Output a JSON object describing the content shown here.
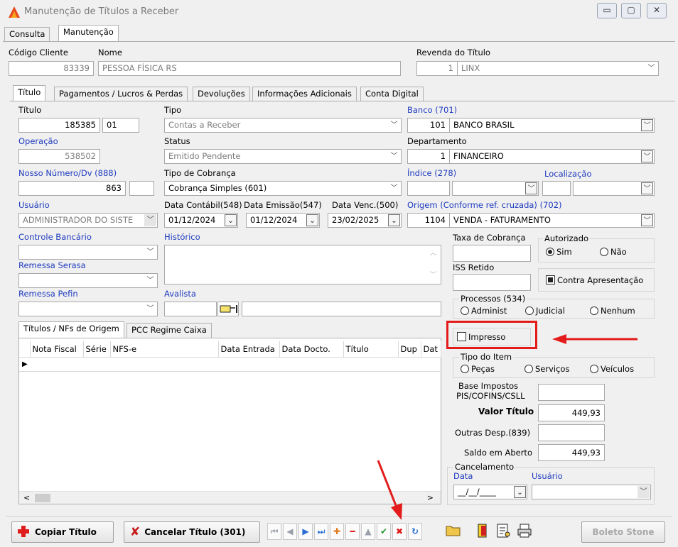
{
  "window": {
    "title": "Manutenção de Títulos a Receber",
    "min": "▭",
    "max": "▢",
    "close": "✕"
  },
  "main_tabs": [
    "Consulta",
    "Manutenção"
  ],
  "header": {
    "codigo_label": "Código Cliente",
    "codigo_value": "83339",
    "nome_label": "Nome",
    "nome_value": "PESSOA FÍSICA RS",
    "revenda_label": "Revenda do Título",
    "revenda_code": "1",
    "revenda_value": "LINX"
  },
  "sub_tabs": [
    "Título",
    "Pagamentos / Lucros & Perdas",
    "Devoluções",
    "Informações Adicionais",
    "Conta Digital"
  ],
  "titulo": {
    "titulo_label": "Título",
    "titulo_value": "185385",
    "parcela_value": "01",
    "tipo_label": "Tipo",
    "tipo_value": "Contas a Receber",
    "banco_label": "Banco (701)",
    "banco_code": "101",
    "banco_value": "BANCO BRASIL",
    "operacao_label": "Operação",
    "operacao_value": "538502",
    "status_label": "Status",
    "status_value": "Emitido Pendente",
    "departamento_label": "Departamento",
    "departamento_code": "1",
    "departamento_value": "FINANCEIRO",
    "nosso_label": "Nosso Número/Dv (888)",
    "nosso_value": "863",
    "cobranca_label": "Tipo de Cobrança",
    "cobranca_value": "Cobrança Simples (601)",
    "indice_label": "Índice (278)",
    "localizacao_label": "Localização",
    "usuario_label": "Usuário",
    "usuario_value": "ADMINISTRADOR DO SISTE",
    "data_contabil_label": "Data Contábil(548)",
    "data_contabil_value": "01/12/2024",
    "data_emissao_label": "Data Emissão(547)",
    "data_emissao_value": "01/12/2024",
    "data_venc_label": "Data Venc.(500)",
    "data_venc_value": "23/02/2025",
    "origem_label": "Origem (Conforme ref. cruzada) (702)",
    "origem_code": "1104",
    "origem_value": "VENDA - FATURAMENTO",
    "controle_label": "Controle Bancário",
    "historico_label": "Histórico",
    "serasa_label": "Remessa Serasa",
    "pefin_label": "Remessa Pefin",
    "avalista_label": "Avalista"
  },
  "right": {
    "taxa_label": "Taxa de Cobrança",
    "autorizado_label": "Autorizado",
    "sim": "Sim",
    "nao": "Não",
    "iss_label": "ISS Retido",
    "contra_label": "Contra Apresentação",
    "processos_label": "Processos (534)",
    "administ": "Administ",
    "judicial": "Judicial",
    "nenhum": "Nenhum",
    "impresso_label": "Impresso",
    "tipo_item_label": "Tipo do Item",
    "pecas": "Peças",
    "servicos": "Serviços",
    "veiculos": "Veículos",
    "base_label1": "Base Impostos",
    "base_label2": "PIS/COFINS/CSLL",
    "valor_label": "Valor Título",
    "valor_value": "449,93",
    "outras_label": "Outras Desp.(839)",
    "saldo_label": "Saldo em Aberto",
    "saldo_value": "449,93",
    "cancel_label": "Cancelamento",
    "cancel_data_label": "Data",
    "cancel_usuario_label": "Usuário",
    "cancel_data_value": "__/__/____"
  },
  "grid_tabs": [
    "Títulos / NFs de Origem",
    "PCC Regime Caixa"
  ],
  "grid_columns": [
    "Nota Fiscal",
    "Série",
    "NFS-e",
    "Data Entrada",
    "Data Docto.",
    "Título",
    "Dup",
    "Dat"
  ],
  "buttons": {
    "copiar": "Copiar Título",
    "cancelar": "Cancelar Título (301)",
    "boleto": "Boleto Stone"
  },
  "colors": {
    "highlight": "#e31b1b",
    "blue_label": "#1f3bbf"
  }
}
